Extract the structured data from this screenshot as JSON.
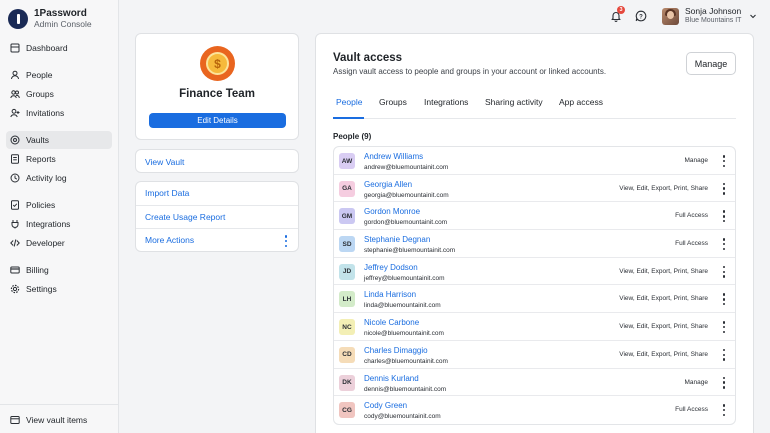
{
  "brand": {
    "name": "1Password",
    "subtitle": "Admin Console"
  },
  "sidebar": {
    "items": [
      {
        "label": "Dashboard",
        "icon": "dashboard-icon"
      },
      {
        "label": "People",
        "icon": "person-icon"
      },
      {
        "label": "Groups",
        "icon": "groups-icon"
      },
      {
        "label": "Invitations",
        "icon": "invitations-icon"
      },
      {
        "label": "Vaults",
        "icon": "vault-icon",
        "active": true
      },
      {
        "label": "Reports",
        "icon": "reports-icon"
      },
      {
        "label": "Activity log",
        "icon": "activity-icon"
      },
      {
        "label": "Policies",
        "icon": "policies-icon"
      },
      {
        "label": "Integrations",
        "icon": "integrations-icon"
      },
      {
        "label": "Developer",
        "icon": "developer-icon"
      },
      {
        "label": "Billing",
        "icon": "billing-icon"
      },
      {
        "label": "Settings",
        "icon": "settings-icon"
      }
    ],
    "footer_label": "View vault items"
  },
  "topbar": {
    "notification_count": "3",
    "user_name": "Sonja Johnson",
    "user_org": "Blue Mountains IT"
  },
  "team": {
    "name": "Finance Team",
    "edit_label": "Edit Details"
  },
  "links": {
    "view_vault": "View Vault",
    "import_data": "Import Data",
    "create_usage_report": "Create Usage Report",
    "more_actions": "More Actions"
  },
  "vault_access": {
    "title": "Vault access",
    "subtitle": "Assign vault access to people and groups in your account or linked accounts.",
    "manage_label": "Manage",
    "tabs": [
      "People",
      "Groups",
      "Integrations",
      "Sharing activity",
      "App access"
    ],
    "active_tab": "People",
    "people_header": "People (9)",
    "people": [
      {
        "initials": "AW",
        "name": "Andrew Williams",
        "email": "andrew@bluemountainit.com",
        "access": "Manage",
        "color": "#d9cdf3"
      },
      {
        "initials": "GA",
        "name": "Georgia Allen",
        "email": "georgia@bluemountainit.com",
        "access": "View, Edit, Export, Print, Share",
        "color": "#f5cde0"
      },
      {
        "initials": "GM",
        "name": "Gordon Monroe",
        "email": "gordon@bluemountainit.com",
        "access": "Full Access",
        "color": "#cbc8f2"
      },
      {
        "initials": "SD",
        "name": "Stephanie Degnan",
        "email": "stephanie@bluemountainit.com",
        "access": "Full Access",
        "color": "#bcd7f3"
      },
      {
        "initials": "JD",
        "name": "Jeffrey Dodson",
        "email": "jeffrey@bluemountainit.com",
        "access": "View, Edit, Export, Print, Share",
        "color": "#c2e3ea"
      },
      {
        "initials": "LH",
        "name": "Linda Harrison",
        "email": "linda@bluemountainit.com",
        "access": "View, Edit, Export, Print, Share",
        "color": "#d3ebc9"
      },
      {
        "initials": "NC",
        "name": "Nicole Carbone",
        "email": "nicole@bluemountainit.com",
        "access": "View, Edit, Export, Print, Share",
        "color": "#f3efb5"
      },
      {
        "initials": "CD",
        "name": "Charles Dimaggio",
        "email": "charles@bluemountainit.com",
        "access": "View, Edit, Export, Print, Share",
        "color": "#f5dcb8"
      },
      {
        "initials": "DK",
        "name": "Dennis Kurland",
        "email": "dennis@bluemountainit.com",
        "access": "Manage",
        "color": "#ecd0da"
      },
      {
        "initials": "CG",
        "name": "Cody Green",
        "email": "cody@bluemountainit.com",
        "access": "Full Access",
        "color": "#f0c5c0"
      }
    ]
  }
}
